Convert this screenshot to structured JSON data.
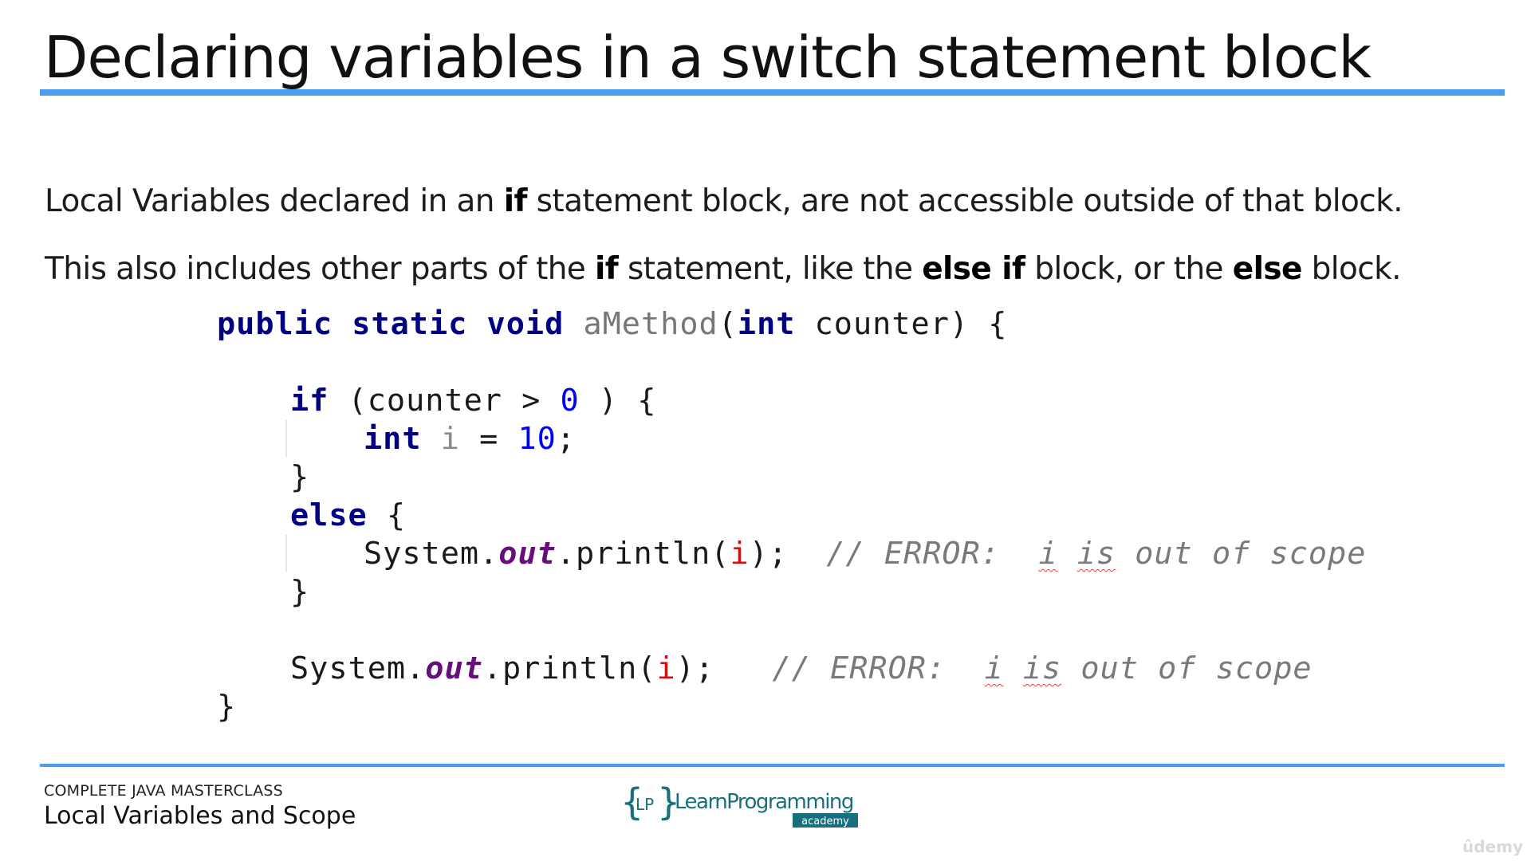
{
  "slide": {
    "title": "Declaring variables in a switch statement block",
    "paragraph1": {
      "before": "Local Variables declared in an ",
      "kw1": "if",
      "after": " statement block, are not accessible outside of that block."
    },
    "paragraph2": {
      "part1": "This also includes other parts of the ",
      "kw1": "if",
      "part2": " statement, like the ",
      "kw2": "else if",
      "part3": " block, or the ",
      "kw3": "else",
      "part4": " block."
    }
  },
  "code": {
    "kw_public": "public",
    "kw_static": "static",
    "kw_void": "void",
    "method_name": "aMethod",
    "open_paren": "(",
    "kw_int": "int",
    "param": " counter) {",
    "kw_if": "if",
    "if_cond": " (counter > ",
    "if_num": "0",
    "if_close": " ) {",
    "var_type": "int",
    "var_name": "i",
    "var_eq": " = ",
    "var_num": "10",
    "semicolon": ";",
    "brace_close": "}",
    "kw_else": "else",
    "else_open": " {",
    "sys": "System.",
    "out": "out",
    "println_open": ".println(",
    "err_var": "i",
    "println_close": ");",
    "comment_prefix": "// ERROR:  ",
    "comment_i": "i",
    "comment_space": " ",
    "comment_is": "is",
    "comment_suffix": " out of scope"
  },
  "footer": {
    "course": "COMPLETE JAVA MASTERCLASS",
    "lesson": "Local Variables and Scope",
    "logo_left": "{",
    "logo_mark": "LP",
    "logo_right": "}",
    "logo_text": "LearnProgramming",
    "logo_sub": "academy",
    "watermark": "ûdemy"
  },
  "colors": {
    "accent_rule": "#4a9df0",
    "keyword": "#000080",
    "number": "#0000ff",
    "field": "#660e7a",
    "error": "#d01010",
    "comment": "#7a7a7a",
    "logo_teal": "#18707e"
  }
}
